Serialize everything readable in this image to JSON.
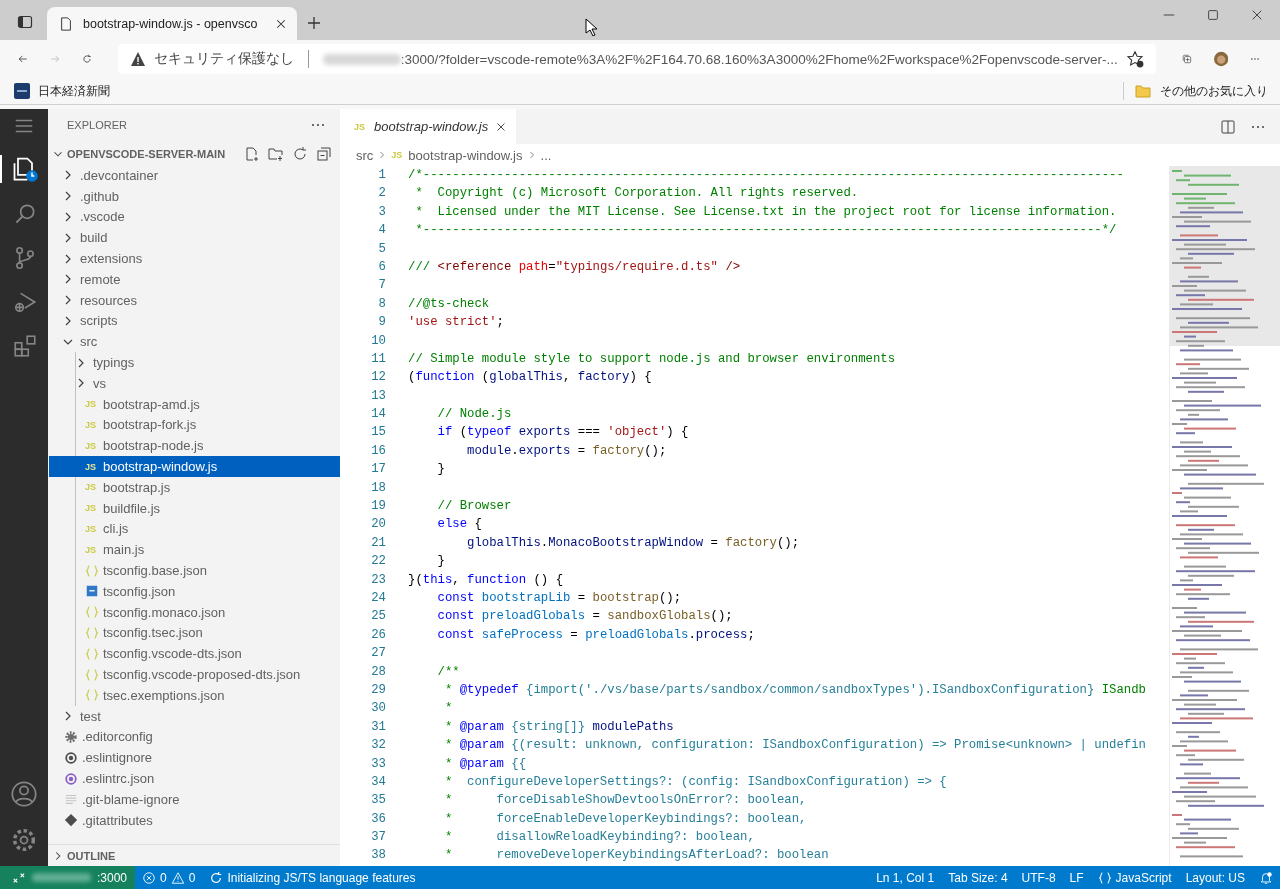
{
  "browser": {
    "tab": {
      "title": "bootstrap-window.js - openvsco",
      "selected": true
    },
    "address": {
      "security": "セキュリティ保護なし",
      "url": ":3000/?folder=vscode-remote%3A%2F%2F164.70.68.160%3A3000%2Fhome%2Fworkspace%2Fopenvscode-server-..."
    },
    "bookmarks": [
      {
        "label": "日本経済新聞"
      }
    ],
    "other_bookmarks": "その他のお気に入り"
  },
  "activity_bar": [
    {
      "kind": "explorer",
      "selected": true
    },
    {
      "kind": "search",
      "selected": false
    },
    {
      "kind": "scm",
      "selected": false
    },
    {
      "kind": "debug",
      "selected": false
    },
    {
      "kind": "extensions",
      "selected": false
    }
  ],
  "explorer": {
    "title": "EXPLORER",
    "root": {
      "label": "OPENVSCODE-SERVER-MAIN",
      "expanded": true
    },
    "tree": [
      {
        "name": ".devcontainer",
        "kind": "folder",
        "expanded": false
      },
      {
        "name": ".github",
        "kind": "folder",
        "expanded": false
      },
      {
        "name": ".vscode",
        "kind": "folder",
        "expanded": false
      },
      {
        "name": "build",
        "kind": "folder",
        "expanded": false
      },
      {
        "name": "extensions",
        "kind": "folder",
        "expanded": false
      },
      {
        "name": "remote",
        "kind": "folder",
        "expanded": false
      },
      {
        "name": "resources",
        "kind": "folder",
        "expanded": false
      },
      {
        "name": "scripts",
        "kind": "folder",
        "expanded": false
      },
      {
        "name": "src",
        "kind": "folder",
        "expanded": true,
        "children": [
          {
            "name": "typings",
            "kind": "folder",
            "expanded": false
          },
          {
            "name": "vs",
            "kind": "folder",
            "expanded": false
          },
          {
            "name": "bootstrap-amd.js",
            "kind": "js",
            "badge": "JS",
            "selected": false
          },
          {
            "name": "bootstrap-fork.js",
            "kind": "js",
            "badge": "JS",
            "selected": false
          },
          {
            "name": "bootstrap-node.js",
            "kind": "js",
            "badge": "JS",
            "selected": false
          },
          {
            "name": "bootstrap-window.js",
            "kind": "js",
            "badge": "JS",
            "selected": true
          },
          {
            "name": "bootstrap.js",
            "kind": "js",
            "badge": "JS",
            "selected": false
          },
          {
            "name": "buildfile.js",
            "kind": "js",
            "badge": "JS",
            "selected": false
          },
          {
            "name": "cli.js",
            "kind": "js",
            "badge": "JS",
            "selected": false
          },
          {
            "name": "main.js",
            "kind": "js",
            "badge": "JS",
            "selected": false
          },
          {
            "name": "tsconfig.base.json",
            "kind": "json",
            "selected": false
          },
          {
            "name": "tsconfig.json",
            "kind": "ts",
            "selected": false
          },
          {
            "name": "tsconfig.monaco.json",
            "kind": "json",
            "selected": false
          },
          {
            "name": "tsconfig.tsec.json",
            "kind": "json",
            "selected": false
          },
          {
            "name": "tsconfig.vscode-dts.json",
            "kind": "json",
            "selected": false
          },
          {
            "name": "tsconfig.vscode-proposed-dts.json",
            "kind": "json",
            "selected": false
          },
          {
            "name": "tsec.exemptions.json",
            "kind": "json",
            "selected": false
          }
        ]
      },
      {
        "name": "test",
        "kind": "folder",
        "expanded": false
      },
      {
        "name": ".editorconfig",
        "kind": "config",
        "selected": false
      },
      {
        "name": ".eslintignore",
        "kind": "ignore",
        "selected": false
      },
      {
        "name": ".eslintrc.json",
        "kind": "eslint",
        "selected": false
      },
      {
        "name": ".git-blame-ignore",
        "kind": "text",
        "selected": false
      },
      {
        "name": ".gitattributes",
        "kind": "git",
        "selected": false
      }
    ],
    "outline": {
      "label": "OUTLINE",
      "expanded": false
    }
  },
  "editor": {
    "tabs": [
      {
        "badge": "JS",
        "title": "bootstrap-window.js",
        "selected": true
      }
    ],
    "breadcrumbs": {
      "folder": "src",
      "badge": "JS",
      "file": "bootstrap-window.js",
      "more": "..."
    },
    "lines": [
      {
        "number": "1",
        "tokens": [
          {
            "kind": "comment",
            "text": "/*-----------------------------------------------------------------------------------------------"
          }
        ]
      },
      {
        "number": "2",
        "tokens": [
          {
            "kind": "comment",
            "text": " *  Copyright (c) Microsoft Corporation. All rights reserved."
          }
        ]
      },
      {
        "number": "3",
        "tokens": [
          {
            "kind": "comment",
            "text": " *  Licensed under the MIT License. See License.txt in the project root for license information."
          }
        ]
      },
      {
        "number": "4",
        "tokens": [
          {
            "kind": "comment",
            "text": " *--------------------------------------------------------------------------------------------*/"
          }
        ]
      },
      {
        "number": "5"
      },
      {
        "number": "6",
        "tokens": [
          {
            "kind": "comment",
            "text": "/// "
          },
          {
            "kind": "tag",
            "text": "<reference "
          },
          {
            "kind": "attr",
            "text": "path"
          },
          {
            "kind": "plain",
            "text": "="
          },
          {
            "kind": "string",
            "text": "\"typings/require.d.ts\""
          },
          {
            "kind": "tag",
            "text": " />"
          }
        ]
      },
      {
        "number": "7"
      },
      {
        "number": "8",
        "tokens": [
          {
            "kind": "comment",
            "text": "//@ts-check"
          }
        ]
      },
      {
        "number": "9",
        "tokens": [
          {
            "kind": "string",
            "text": "'use strict'"
          },
          {
            "kind": "plain",
            "text": ";"
          }
        ]
      },
      {
        "number": "10"
      },
      {
        "number": "11",
        "tokens": [
          {
            "kind": "comment",
            "text": "// Simple module style to support node.js and browser environments"
          }
        ]
      },
      {
        "number": "12",
        "tokens": [
          {
            "kind": "plain",
            "text": "("
          },
          {
            "kind": "keyword",
            "text": "function"
          },
          {
            "kind": "plain",
            "text": " ("
          },
          {
            "kind": "variable",
            "text": "globalThis"
          },
          {
            "kind": "plain",
            "text": ", "
          },
          {
            "kind": "variable",
            "text": "factory"
          },
          {
            "kind": "plain",
            "text": ") {"
          }
        ]
      },
      {
        "number": "13"
      },
      {
        "number": "14",
        "tokens": [
          {
            "kind": "comment",
            "text": "    // Node.js"
          }
        ]
      },
      {
        "number": "15",
        "tokens": [
          {
            "kind": "keyword",
            "text": "    if"
          },
          {
            "kind": "plain",
            "text": " ("
          },
          {
            "kind": "keyword",
            "text": "typeof"
          },
          {
            "kind": "variable",
            "text": " exports"
          },
          {
            "kind": "plain",
            "text": " === "
          },
          {
            "kind": "string",
            "text": "'object'"
          },
          {
            "kind": "plain",
            "text": ") {"
          }
        ]
      },
      {
        "number": "16",
        "tokens": [
          {
            "kind": "variable",
            "text": "        module"
          },
          {
            "kind": "plain",
            "text": "."
          },
          {
            "kind": "variable",
            "text": "exports"
          },
          {
            "kind": "plain",
            "text": " = "
          },
          {
            "kind": "function",
            "text": "factory"
          },
          {
            "kind": "plain",
            "text": "();"
          }
        ]
      },
      {
        "number": "17",
        "tokens": [
          {
            "kind": "plain",
            "text": "    }"
          }
        ]
      },
      {
        "number": "18"
      },
      {
        "number": "19",
        "tokens": [
          {
            "kind": "comment",
            "text": "    // Browser"
          }
        ]
      },
      {
        "number": "20",
        "tokens": [
          {
            "kind": "keyword",
            "text": "    else"
          },
          {
            "kind": "plain",
            "text": " {"
          }
        ]
      },
      {
        "number": "21",
        "tokens": [
          {
            "kind": "variable",
            "text": "        globalThis"
          },
          {
            "kind": "plain",
            "text": "."
          },
          {
            "kind": "variable",
            "text": "MonacoBootstrapWindow"
          },
          {
            "kind": "plain",
            "text": " = "
          },
          {
            "kind": "function",
            "text": "factory"
          },
          {
            "kind": "plain",
            "text": "();"
          }
        ]
      },
      {
        "number": "22",
        "tokens": [
          {
            "kind": "plain",
            "text": "    }"
          }
        ]
      },
      {
        "number": "23",
        "tokens": [
          {
            "kind": "plain",
            "text": "}("
          },
          {
            "kind": "keyword",
            "text": "this"
          },
          {
            "kind": "plain",
            "text": ", "
          },
          {
            "kind": "keyword",
            "text": "function"
          },
          {
            "kind": "plain",
            "text": " () {"
          }
        ]
      },
      {
        "number": "24",
        "tokens": [
          {
            "kind": "keyword",
            "text": "    const"
          },
          {
            "kind": "constant",
            "text": " bootstrapLib"
          },
          {
            "kind": "plain",
            "text": " = "
          },
          {
            "kind": "function",
            "text": "bootstrap"
          },
          {
            "kind": "plain",
            "text": "();"
          }
        ]
      },
      {
        "number": "25",
        "tokens": [
          {
            "kind": "keyword",
            "text": "    const"
          },
          {
            "kind": "constant",
            "text": " preloadGlobals"
          },
          {
            "kind": "plain",
            "text": " = "
          },
          {
            "kind": "function",
            "text": "sandboxGlobals"
          },
          {
            "kind": "plain",
            "text": "();"
          }
        ]
      },
      {
        "number": "26",
        "tokens": [
          {
            "kind": "keyword",
            "text": "    const"
          },
          {
            "kind": "constant",
            "text": " safeProcess"
          },
          {
            "kind": "plain",
            "text": " = "
          },
          {
            "kind": "constant",
            "text": "preloadGlobals"
          },
          {
            "kind": "plain",
            "text": "."
          },
          {
            "kind": "variable",
            "text": "process"
          },
          {
            "kind": "plain",
            "text": ";"
          }
        ]
      },
      {
        "number": "27"
      },
      {
        "number": "28",
        "tokens": [
          {
            "kind": "comment",
            "text": "    /**"
          }
        ]
      },
      {
        "number": "29",
        "tokens": [
          {
            "kind": "comment",
            "text": "     * "
          },
          {
            "kind": "doctag",
            "text": "@typedef"
          },
          {
            "kind": "type",
            "text": " {import('./vs/base/parts/sandbox/common/sandboxTypes').ISandboxConfiguration}"
          },
          {
            "kind": "comment",
            "text": " ISandb"
          }
        ]
      },
      {
        "number": "30",
        "tokens": [
          {
            "kind": "comment",
            "text": "     *"
          }
        ]
      },
      {
        "number": "31",
        "tokens": [
          {
            "kind": "comment",
            "text": "     * "
          },
          {
            "kind": "doctag",
            "text": "@param"
          },
          {
            "kind": "type",
            "text": " {string[]}"
          },
          {
            "kind": "doctext",
            "text": " modulePaths"
          }
        ]
      },
      {
        "number": "32",
        "tokens": [
          {
            "kind": "comment",
            "text": "     * "
          },
          {
            "kind": "doctag",
            "text": "@param"
          },
          {
            "kind": "type",
            "text": " {(result: unknown, configuration: ISandboxConfiguration) => Promise<unknown> | undefin"
          }
        ]
      },
      {
        "number": "33",
        "tokens": [
          {
            "kind": "comment",
            "text": "     * "
          },
          {
            "kind": "doctag",
            "text": "@param"
          },
          {
            "kind": "type",
            "text": " {{"
          }
        ]
      },
      {
        "number": "34",
        "tokens": [
          {
            "kind": "comment",
            "text": "     * "
          },
          {
            "kind": "type",
            "text": " configureDeveloperSettings?: (config: ISandboxConfiguration) => {"
          }
        ]
      },
      {
        "number": "35",
        "tokens": [
          {
            "kind": "comment",
            "text": "     * "
          },
          {
            "kind": "type",
            "text": "     forceDisableShowDevtoolsOnError?: boolean,"
          }
        ]
      },
      {
        "number": "36",
        "tokens": [
          {
            "kind": "comment",
            "text": "     * "
          },
          {
            "kind": "type",
            "text": "     forceEnableDeveloperKeybindings?: boolean,"
          }
        ]
      },
      {
        "number": "37",
        "tokens": [
          {
            "kind": "comment",
            "text": "     * "
          },
          {
            "kind": "type",
            "text": "     disallowReloadKeybinding?: boolean,"
          }
        ]
      },
      {
        "number": "38",
        "tokens": [
          {
            "kind": "comment",
            "text": "     * "
          },
          {
            "kind": "type",
            "text": "     removeDeveloperKeybindingsAfterLoad?: boolean"
          }
        ]
      }
    ]
  },
  "status_bar": {
    "remote": ":3000",
    "errors": "0",
    "warnings": "0",
    "message": "Initializing JS/TS language features",
    "right": [
      {
        "kind": "text",
        "label": "Ln 1, Col 1"
      },
      {
        "kind": "text",
        "label": "Tab Size: 4"
      },
      {
        "kind": "text",
        "label": "UTF-8"
      },
      {
        "kind": "text",
        "label": "LF"
      },
      {
        "kind": "language",
        "label": "JavaScript"
      },
      {
        "kind": "text",
        "label": "Layout: US"
      },
      {
        "kind": "bell"
      }
    ]
  }
}
